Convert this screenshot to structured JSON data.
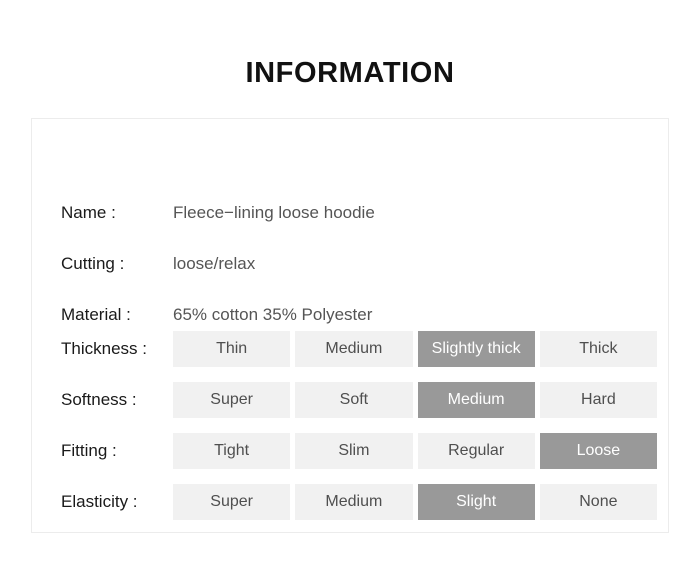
{
  "page": {
    "title": "INFORMATION",
    "background_color": "#ffffff",
    "card_border_color": "#ececec",
    "cell_color": "#f1f1f1",
    "cell_selected_color": "#999999",
    "label_color": "#1a1a1a",
    "value_color": "#555555"
  },
  "info": {
    "text_rows": [
      {
        "label": "Name :",
        "value": "Fleece−lining loose hoodie"
      },
      {
        "label": "Cutting :",
        "value": "loose/relax"
      },
      {
        "label": "Material :",
        "value": "65% cotton 35% Polyester"
      }
    ],
    "option_rows": [
      {
        "label": "Thickness :",
        "options": [
          "Thin",
          "Medium",
          "Slightly thick",
          "Thick"
        ],
        "selected_index": 2,
        "selected_value": "Slightly thick"
      },
      {
        "label": "Softness :",
        "options": [
          "Super",
          "Soft",
          "Medium",
          "Hard"
        ],
        "selected_index": 2,
        "selected_value": "Medium"
      },
      {
        "label": "Fitting :",
        "options": [
          "Tight",
          "Slim",
          "Regular",
          "Loose"
        ],
        "selected_index": 3,
        "selected_value": "Loose"
      },
      {
        "label": "Elasticity :",
        "options": [
          "Super",
          "Medium",
          "Slight",
          "None"
        ],
        "selected_index": 2,
        "selected_value": "Slight"
      }
    ]
  }
}
